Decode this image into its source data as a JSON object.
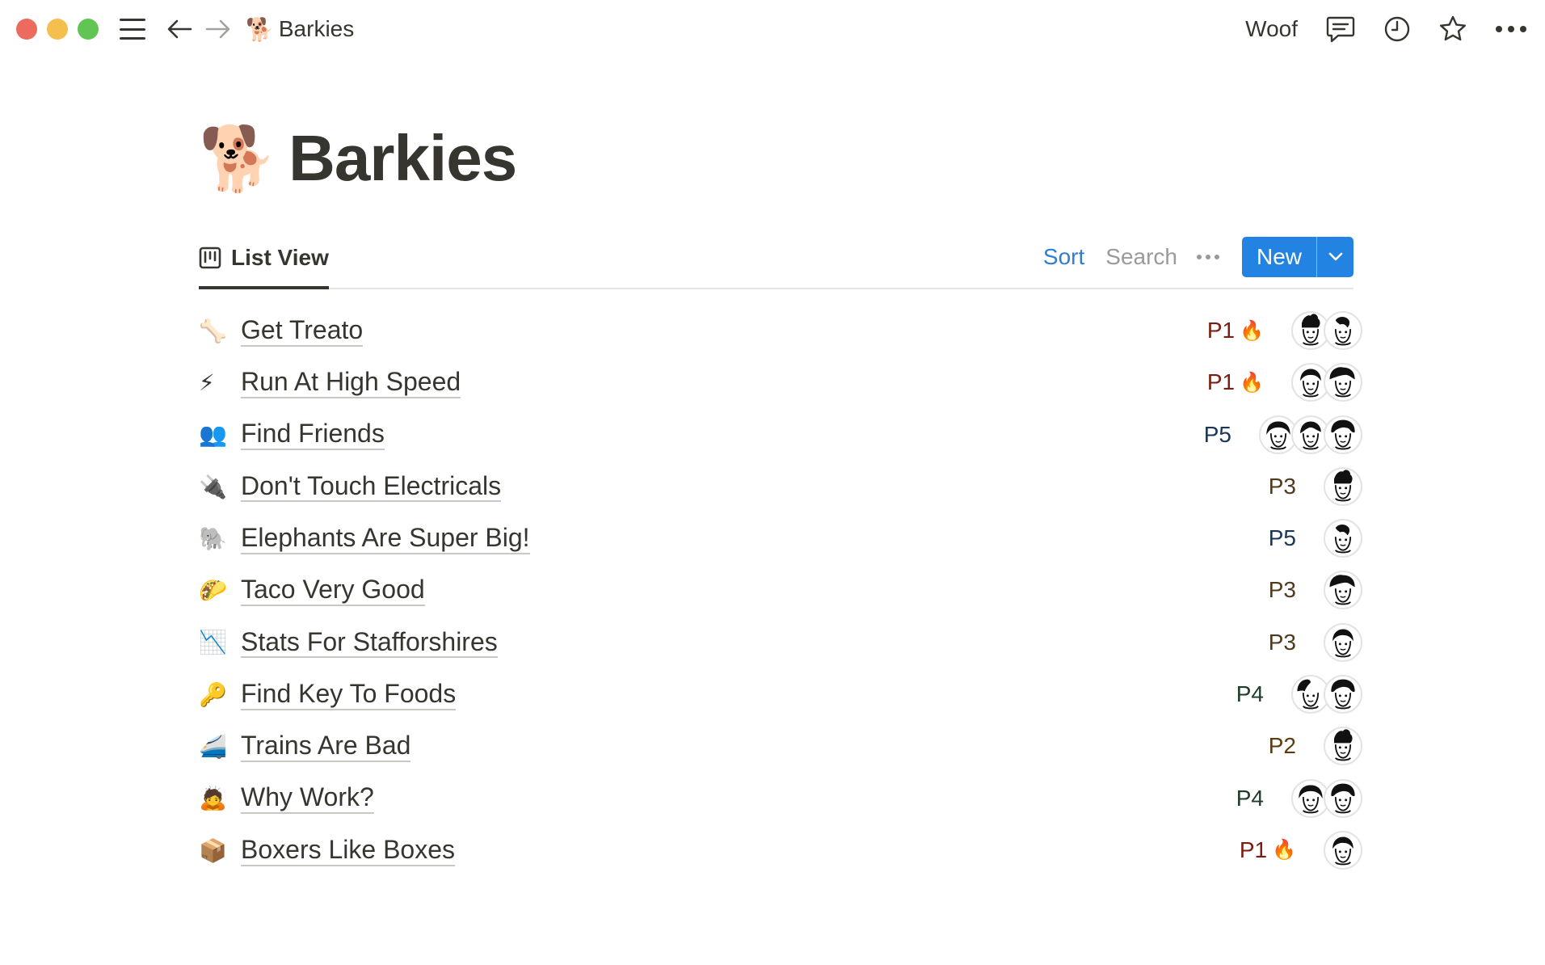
{
  "window": {
    "breadcrumb_title": "Barkies",
    "breadcrumb_emoji": "🐕"
  },
  "topbar": {
    "workspace_label": "Woof"
  },
  "page": {
    "title": "Barkies",
    "emoji": "🐕"
  },
  "view": {
    "tab_label": "List View",
    "sort_label": "Sort",
    "search_label": "Search",
    "new_label": "New"
  },
  "colors": {
    "accent_blue": "#2383e2",
    "sort_blue": "#2e7ed3",
    "text": "#37352f"
  },
  "rows": [
    {
      "icon": "🦴",
      "title": "Get Treato",
      "priority": "P1",
      "hot": true,
      "avatars": [
        "avatar-a",
        "avatar-b"
      ]
    },
    {
      "icon": "⚡",
      "title": "Run At High Speed",
      "priority": "P1",
      "hot": true,
      "avatars": [
        "avatar-c",
        "avatar-d"
      ]
    },
    {
      "icon": "👥",
      "title": "Find Friends",
      "priority": "P5",
      "hot": false,
      "avatars": [
        "avatar-e",
        "avatar-f",
        "avatar-g"
      ]
    },
    {
      "icon": "🔌",
      "title": "Don't Touch Electricals",
      "priority": "P3",
      "hot": false,
      "avatars": [
        "avatar-a"
      ]
    },
    {
      "icon": "🐘",
      "title": "Elephants Are Super Big!",
      "priority": "P5",
      "hot": false,
      "avatars": [
        "avatar-b"
      ]
    },
    {
      "icon": "🌮",
      "title": "Taco Very Good",
      "priority": "P3",
      "hot": false,
      "avatars": [
        "avatar-d"
      ]
    },
    {
      "icon": "📉",
      "title": "Stats For Stafforshires",
      "priority": "P3",
      "hot": false,
      "avatars": [
        "avatar-c"
      ]
    },
    {
      "icon": "🔑",
      "title": "Find Key To Foods",
      "priority": "P4",
      "hot": false,
      "avatars": [
        "avatar-h",
        "avatar-g"
      ]
    },
    {
      "icon": "🚄",
      "title": "Trains Are Bad",
      "priority": "P2",
      "hot": false,
      "avatars": [
        "avatar-a"
      ]
    },
    {
      "icon": "🙇",
      "title": "Why Work?",
      "priority": "P4",
      "hot": false,
      "avatars": [
        "avatar-e",
        "avatar-g"
      ]
    },
    {
      "icon": "📦",
      "title": "Boxers Like Boxes",
      "priority": "P1",
      "hot": true,
      "avatars": [
        "avatar-c"
      ]
    }
  ]
}
